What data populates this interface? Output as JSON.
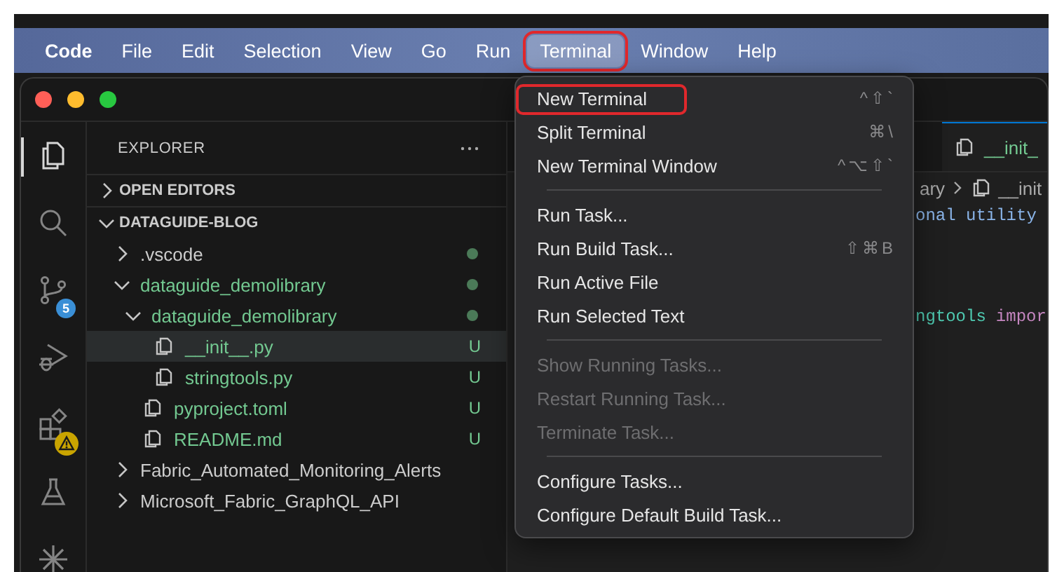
{
  "menu_bar": {
    "items": [
      {
        "label": "Code",
        "kind": "app",
        "selected": false,
        "annotated": false
      },
      {
        "label": "File",
        "kind": "menu",
        "selected": false,
        "annotated": false
      },
      {
        "label": "Edit",
        "kind": "menu",
        "selected": false,
        "annotated": false
      },
      {
        "label": "Selection",
        "kind": "menu",
        "selected": false,
        "annotated": false
      },
      {
        "label": "View",
        "kind": "menu",
        "selected": false,
        "annotated": false
      },
      {
        "label": "Go",
        "kind": "menu",
        "selected": false,
        "annotated": false
      },
      {
        "label": "Run",
        "kind": "menu",
        "selected": false,
        "annotated": false
      },
      {
        "label": "Terminal",
        "kind": "menu",
        "selected": true,
        "annotated": true
      },
      {
        "label": "Window",
        "kind": "menu",
        "selected": false,
        "annotated": false
      },
      {
        "label": "Help",
        "kind": "menu",
        "selected": false,
        "annotated": false
      }
    ]
  },
  "activity_bar": {
    "items": [
      {
        "kind": "files",
        "selected": true
      },
      {
        "kind": "search",
        "selected": false
      },
      {
        "kind": "source-control",
        "selected": false,
        "badge": "5"
      },
      {
        "kind": "run-debug",
        "selected": false
      },
      {
        "kind": "extensions",
        "selected": false,
        "warning": true
      },
      {
        "kind": "testing",
        "selected": false
      },
      {
        "kind": "spark",
        "selected": false
      }
    ]
  },
  "explorer": {
    "title": "EXPLORER",
    "sections": [
      {
        "label": "OPEN EDITORS",
        "expanded": false
      },
      {
        "label": "DATAGUIDE-BLOG",
        "expanded": true,
        "children": [
          {
            "kind": "folder",
            "label": ".vscode",
            "expanded": false,
            "untracked": false,
            "dot": true,
            "selected": false
          },
          {
            "kind": "folder",
            "label": "dataguide_demolibrary",
            "expanded": true,
            "untracked": true,
            "dot": true,
            "selected": false,
            "children": [
              {
                "kind": "folder",
                "label": "dataguide_demolibrary",
                "expanded": true,
                "untracked": true,
                "dot": true,
                "selected": false,
                "children": [
                  {
                    "kind": "file",
                    "label": "__init__.py",
                    "untracked": true,
                    "status": "U",
                    "selected": true
                  },
                  {
                    "kind": "file",
                    "label": "stringtools.py",
                    "untracked": true,
                    "status": "U",
                    "selected": false
                  }
                ]
              },
              {
                "kind": "file",
                "label": "pyproject.toml",
                "untracked": true,
                "status": "U",
                "selected": false
              },
              {
                "kind": "file",
                "label": "README.md",
                "untracked": true,
                "status": "U",
                "selected": false
              }
            ]
          },
          {
            "kind": "folder",
            "label": "Fabric_Automated_Monitoring_Alerts",
            "expanded": false,
            "untracked": false,
            "dot": false,
            "selected": false
          },
          {
            "kind": "folder",
            "label": "Microsoft_Fabric_GraphQL_API",
            "expanded": false,
            "untracked": false,
            "dot": false,
            "selected": false
          }
        ]
      }
    ]
  },
  "editor": {
    "tab": {
      "label": "__init_",
      "selected": true
    },
    "breadcrumb": [
      "ary",
      "__init"
    ],
    "code_lines": [
      {
        "tokens": [
          {
            "text": "onal utility",
            "kind": "docstring"
          }
        ]
      },
      {
        "tokens": [
          {
            "text": "ngtools",
            "kind": "module"
          },
          {
            "text": "impor",
            "kind": "keyword"
          }
        ]
      }
    ]
  },
  "terminal_menu": {
    "items": [
      {
        "kind": "item",
        "label": "New Terminal",
        "shortcut": "^⇧`",
        "disabled": false,
        "annotated": true
      },
      {
        "kind": "item",
        "label": "Split Terminal",
        "shortcut": "⌘\\",
        "disabled": false,
        "annotated": false
      },
      {
        "kind": "item",
        "label": "New Terminal Window",
        "shortcut": "^⌥⇧`",
        "disabled": false,
        "annotated": false
      },
      {
        "kind": "separator"
      },
      {
        "kind": "item",
        "label": "Run Task...",
        "disabled": false,
        "annotated": false
      },
      {
        "kind": "item",
        "label": "Run Build Task...",
        "shortcut": "⇧⌘B",
        "disabled": false,
        "annotated": false
      },
      {
        "kind": "item",
        "label": "Run Active File",
        "disabled": false,
        "annotated": false
      },
      {
        "kind": "item",
        "label": "Run Selected Text",
        "disabled": false,
        "annotated": false
      },
      {
        "kind": "separator"
      },
      {
        "kind": "item",
        "label": "Show Running Tasks...",
        "disabled": true,
        "annotated": false
      },
      {
        "kind": "item",
        "label": "Restart Running Task...",
        "disabled": true,
        "annotated": false
      },
      {
        "kind": "item",
        "label": "Terminate Task...",
        "disabled": true,
        "annotated": false
      },
      {
        "kind": "separator"
      },
      {
        "kind": "item",
        "label": "Configure Tasks...",
        "disabled": false,
        "annotated": false
      },
      {
        "kind": "item",
        "label": "Configure Default Build Task...",
        "disabled": false,
        "annotated": false
      }
    ]
  }
}
